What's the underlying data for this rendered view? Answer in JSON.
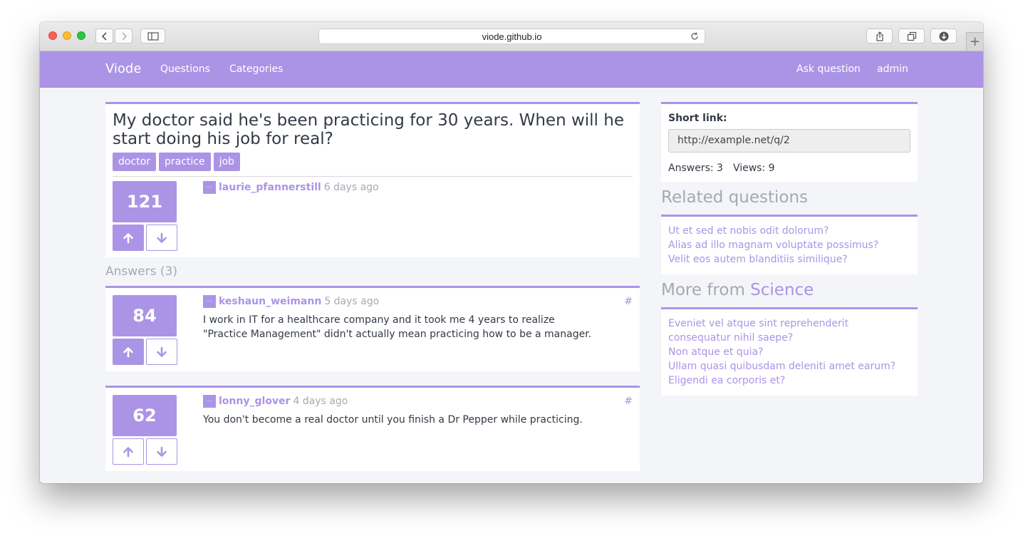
{
  "browser": {
    "url": "viode.github.io",
    "new_tab_label": "+"
  },
  "navbar": {
    "brand": "Viode",
    "links": [
      "Questions",
      "Categories"
    ],
    "right_links": [
      "Ask question",
      "admin"
    ]
  },
  "question": {
    "title": "My doctor said he's been practicing for 30 years. When will he start doing his job for real?",
    "tags": [
      "doctor",
      "practice",
      "job"
    ],
    "score": "121",
    "author": "laurie_pfannerstill",
    "time": "6 days ago"
  },
  "answers_heading": "Answers (3)",
  "answers": [
    {
      "score": "84",
      "author": "keshaun_weimann",
      "time": "5 days ago",
      "anchor": "#",
      "text": "I work in IT for a healthcare company and it took me 4 years to realize \"Practice Management\" didn't actually mean practicing how to be a manager."
    },
    {
      "score": "62",
      "author": "lonny_glover",
      "time": "4 days ago",
      "anchor": "#",
      "text": "You don't become a real doctor until you finish a Dr Pepper while practicing."
    }
  ],
  "sidebar": {
    "short_link_label": "Short link:",
    "short_link_value": "http://example.net/q/2",
    "answers_stat": "Answers: 3",
    "views_stat": "Views: 9",
    "related_title": "Related questions",
    "related": [
      "Ut et sed et nobis odit dolorum?",
      "Alias ad illo magnam voluptate possimus?",
      "Velit eos autem blanditiis similique?"
    ],
    "more_from_prefix": "More from",
    "more_from_category": "Science",
    "more": [
      "Eveniet vel atque sint reprehenderit consequatur nihil saepe?",
      "Non atque et quia?",
      "Ullam quasi quibusdam deleniti amet earum?",
      "Eligendi ea corporis et?"
    ]
  },
  "colors": {
    "accent": "#ab94e6",
    "page_bg": "#f4f5f9",
    "text": "#333a45",
    "muted": "#a8a8b4"
  }
}
